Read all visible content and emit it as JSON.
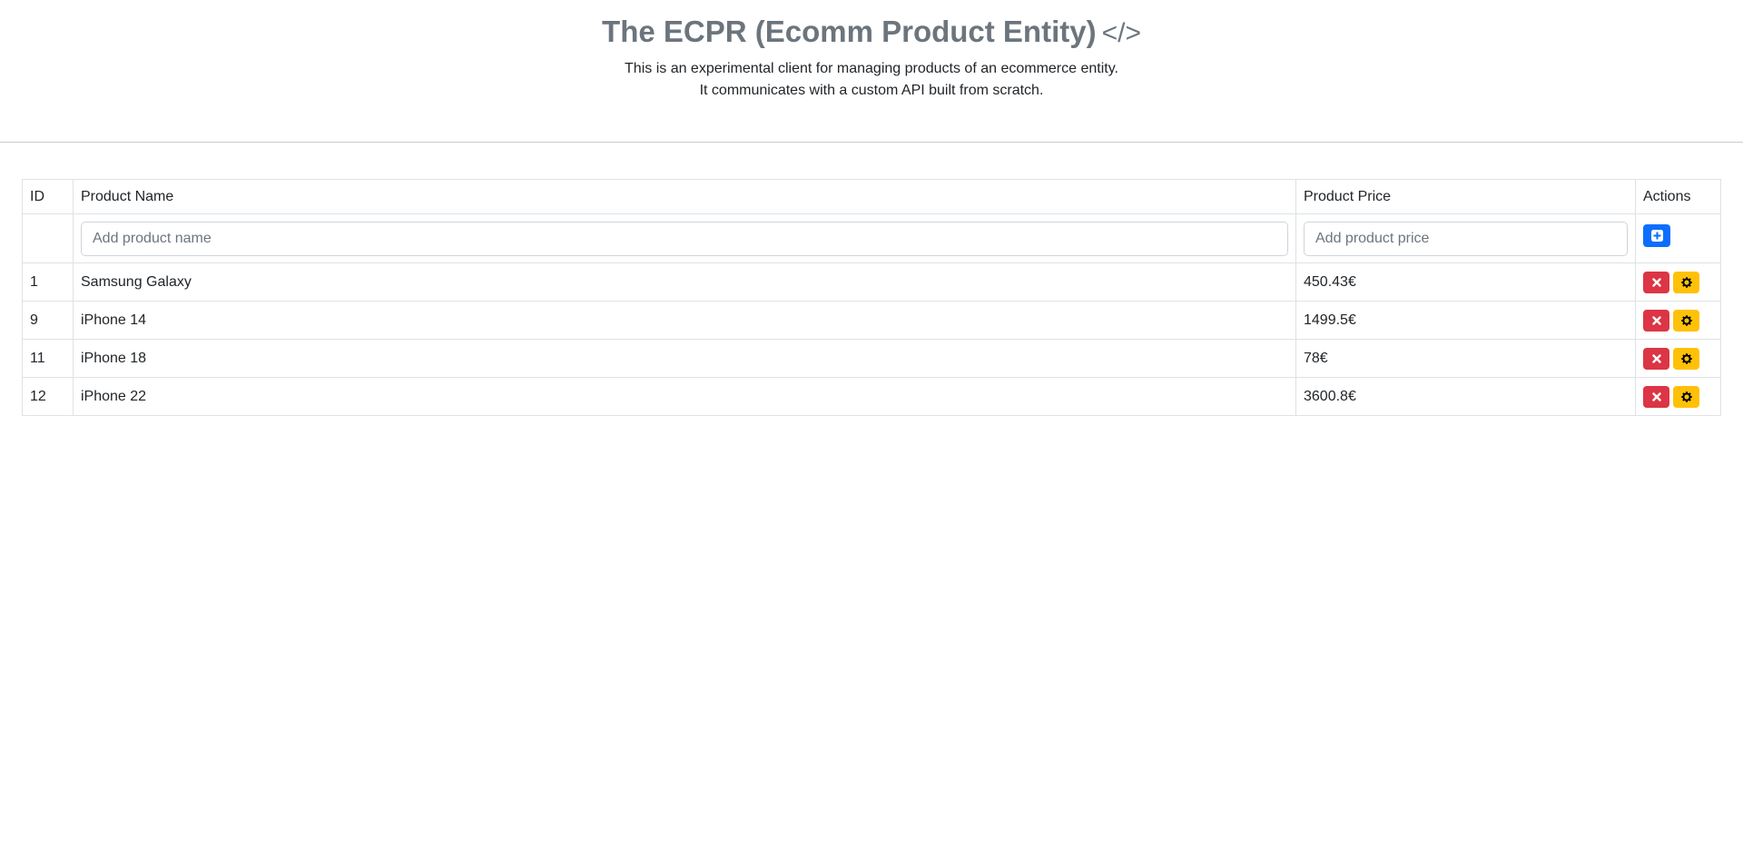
{
  "header": {
    "title": "The ECPR (Ecomm Product Entity)",
    "title_icon": "code-icon",
    "subtitle_line1": "This is an experimental client for managing products of an ecommerce entity.",
    "subtitle_line2": "It communicates with a custom API built from scratch."
  },
  "table": {
    "columns": [
      "ID",
      "Product Name",
      "Product Price",
      "Actions"
    ],
    "add_row": {
      "name_placeholder": "Add product name",
      "price_placeholder": "Add product price",
      "add_icon": "plus-square-icon"
    },
    "rows": [
      {
        "id": "1",
        "name": "Samsung Galaxy",
        "price": "450.43€"
      },
      {
        "id": "9",
        "name": "iPhone 14",
        "price": "1499.5€"
      },
      {
        "id": "11",
        "name": "iPhone 18",
        "price": "78€"
      },
      {
        "id": "12",
        "name": "iPhone 22",
        "price": "3600.8€"
      }
    ],
    "row_actions": {
      "delete_icon": "x-icon",
      "edit_icon": "gear-icon"
    }
  },
  "colors": {
    "title": "#6c757d",
    "add_button": "#0d6efd",
    "delete_button": "#dc3545",
    "edit_button": "#ffc107",
    "border": "#dee2e6"
  }
}
